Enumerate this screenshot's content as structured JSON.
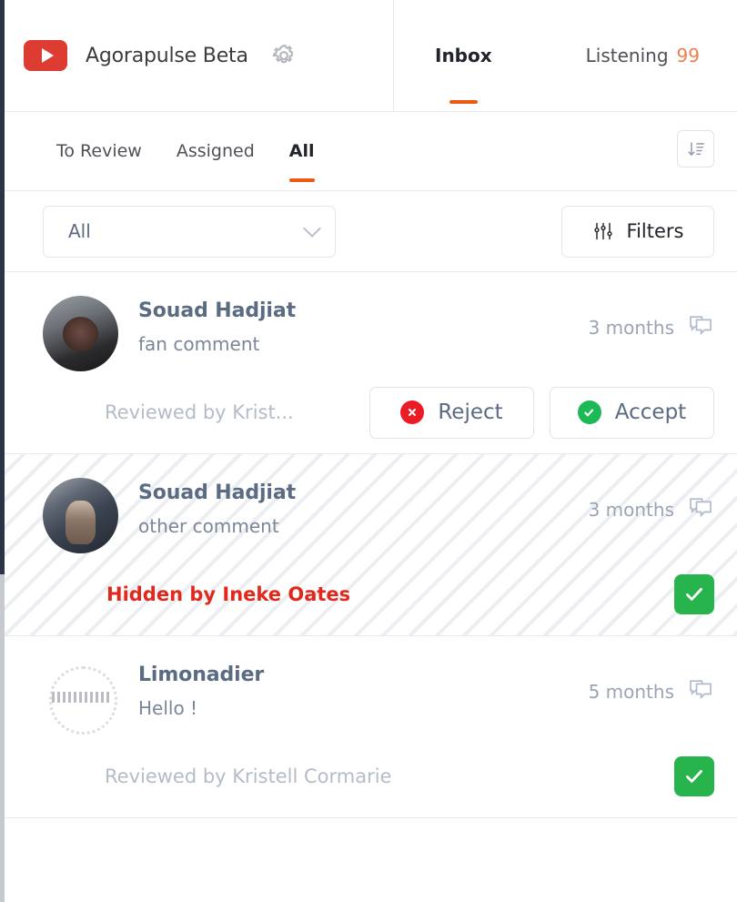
{
  "header": {
    "brand_name": "Agorapulse Beta",
    "brand_icon": "youtube-logo-icon",
    "settings_icon": "gear-icon",
    "nav_tabs": [
      {
        "label": "Inbox",
        "active": true,
        "count": ""
      },
      {
        "label": "Listening",
        "active": false,
        "count": "99"
      }
    ]
  },
  "subtabs": {
    "items": [
      {
        "label": "To Review",
        "active": false
      },
      {
        "label": "Assigned",
        "active": false
      },
      {
        "label": "All",
        "active": true
      }
    ],
    "sort_icon": "sort-descending-icon"
  },
  "filterbar": {
    "select_value": "All",
    "select_chevron_icon": "chevron-down-icon",
    "filters_label": "Filters",
    "filters_icon": "sliders-icon"
  },
  "list": {
    "items": [
      {
        "author": "Souad Hadjiat",
        "snippet": "fan comment",
        "time": "3 months",
        "comment_icon": "comments-bubble-icon",
        "avatar": "avatar-photo-woman",
        "status_text": "Reviewed by Krist...",
        "status_kind": "reviewed",
        "hatched": false,
        "buttons": [
          {
            "label": "Reject",
            "icon": "circle-x-icon",
            "color": "#ec1c24"
          },
          {
            "label": "Accept",
            "icon": "circle-check-icon",
            "color": "#1db954"
          }
        ],
        "check_button": false
      },
      {
        "author": "Souad Hadjiat",
        "snippet": "other comment",
        "time": "3 months",
        "comment_icon": "comments-bubble-icon",
        "avatar": "avatar-photo-person",
        "status_text": "Hidden by Ineke Oates",
        "status_kind": "hidden",
        "hatched": true,
        "buttons": [],
        "check_button": true,
        "check_icon": "check-icon"
      },
      {
        "author": "Limonadier",
        "snippet": "Hello !",
        "time": "5 months",
        "comment_icon": "comments-bubble-icon",
        "avatar": "avatar-logo-limonadier",
        "status_text": "Reviewed by Kristell Cormarie",
        "status_kind": "reviewed",
        "hatched": false,
        "buttons": [],
        "check_button": true,
        "check_icon": "check-icon"
      }
    ]
  },
  "colors": {
    "accent_orange": "#ec5b13",
    "count_orange": "#ec7f4f",
    "reject_red": "#ec1c24",
    "accept_green": "#1db954",
    "check_green": "#28b44c",
    "hidden_red": "#e0281d",
    "author_slate": "#5b6b82",
    "muted_gray": "#b4bcc8",
    "rail_navy": "#2b3445"
  }
}
